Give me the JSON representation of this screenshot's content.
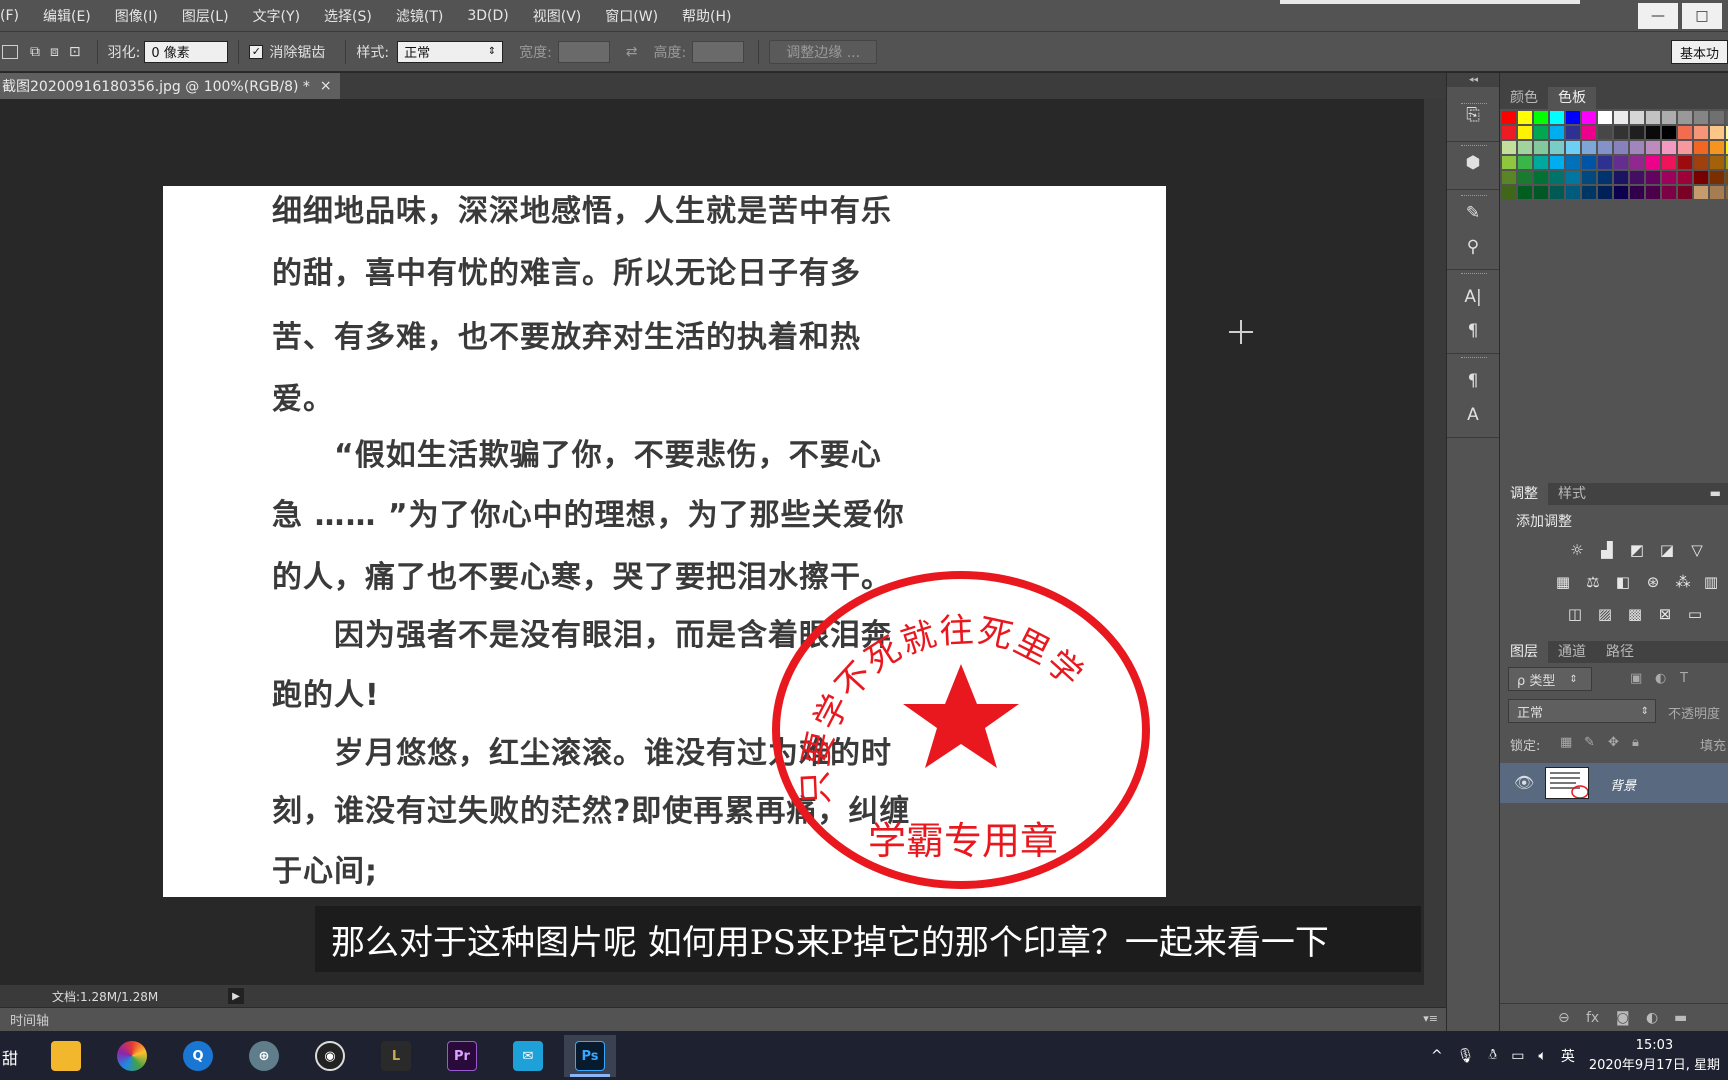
{
  "menubar": {
    "items": [
      "(F)",
      "编辑(E)",
      "图像(I)",
      "图层(L)",
      "文字(Y)",
      "选择(S)",
      "滤镜(T)",
      "3D(D)",
      "视图(V)",
      "窗口(W)",
      "帮助(H)"
    ]
  },
  "options": {
    "feather_label": "羽化:",
    "feather_value": "0 像素",
    "antialias_label": "消除锯齿",
    "antialias_checked": "✓",
    "style_label": "样式:",
    "style_value": "正常",
    "width_label": "宽度:",
    "height_label": "高度:",
    "refine_edge": "调整边缘 ...",
    "workspace": "基本功"
  },
  "document_tab": {
    "title": "截图20200916180356.jpg @ 100%(RGB/8) *",
    "close": "×"
  },
  "document_text": {
    "lines": [
      "细细地品味，深深地感悟，人生就是苦中有乐",
      "的甜，喜中有忧的难言。所以无论日子有多",
      "苦、有多难，也不要放弃对生活的执着和热",
      "爱。",
      "　　“假如生活欺骗了你，不要悲伤，不要心",
      "急 …… ”为了你心中的理想，为了那些关爱你",
      "的人，痛了也不要心寒，哭了要把泪水擦干。",
      "　　因为强者不是没有眼泪，而是含着眼泪奔",
      "跑的人!",
      "　　岁月悠悠，红尘滚滚。谁没有过为难的时",
      "刻，谁没有过失败的茫然?即使再累再痛，纠缠",
      "于心间;"
    ]
  },
  "stamp": {
    "arc_text": "只要学不死就往死里学",
    "bottom_text": "学霸专用章",
    "color": "#e8181e"
  },
  "subtitle": "那么对于这种图片呢  如何用PS来P掉它的那个印章？一起来看一下",
  "status": {
    "doc_info": "文档:1.28M/1.28M",
    "timeline": "时间轴"
  },
  "panels": {
    "color_tab": "颜色",
    "swatches_tab": "色板",
    "adjust_tab": "调整",
    "styles_tab": "样式",
    "add_adjustment": "添加调整",
    "layers_tab": "图层",
    "channels_tab": "通道",
    "paths_tab": "路径",
    "kind_filter": "ρ 类型",
    "blend_mode": "正常",
    "opacity_label": "不透明度",
    "lock_label": "锁定:",
    "fill_label": "填充",
    "layer_name": "背景"
  },
  "taskbar": {
    "left_text": "甜",
    "time": "15:03",
    "date": "2020年9月17日, 星期",
    "ime": "英",
    "apps": [
      "file-explorer",
      "browser-360",
      "browser-q",
      "network-app",
      "obs",
      "league",
      "premiere",
      "mail-app",
      "photoshop"
    ],
    "pr_label": "Pr",
    "ps_label": "Ps"
  },
  "colors": {
    "ui_panel": "#535353",
    "canvas_bg": "#282828",
    "stamp_red": "#e8181e",
    "layer_selected": "#596a80"
  }
}
